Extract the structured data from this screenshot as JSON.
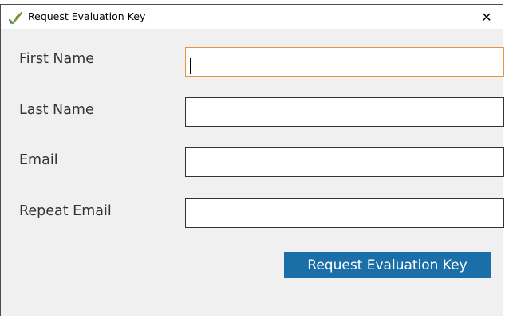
{
  "window": {
    "title": "Request Evaluation Key",
    "app_icon": "brush-checkmark-icon",
    "close_glyph": "✕",
    "close_icon": "close-icon"
  },
  "form": {
    "fields": [
      {
        "label": "First Name",
        "value": "",
        "placeholder": "",
        "focused": true
      },
      {
        "label": "Last Name",
        "value": "",
        "placeholder": ""
      },
      {
        "label": "Email",
        "value": "",
        "placeholder": ""
      },
      {
        "label": "Repeat Email",
        "value": "",
        "placeholder": ""
      }
    ],
    "submit_label": "Request Evaluation Key"
  },
  "colors": {
    "accent": "#1b6fa8",
    "focus_border": "#e8923a",
    "window_bg": "#f0f0f0"
  }
}
